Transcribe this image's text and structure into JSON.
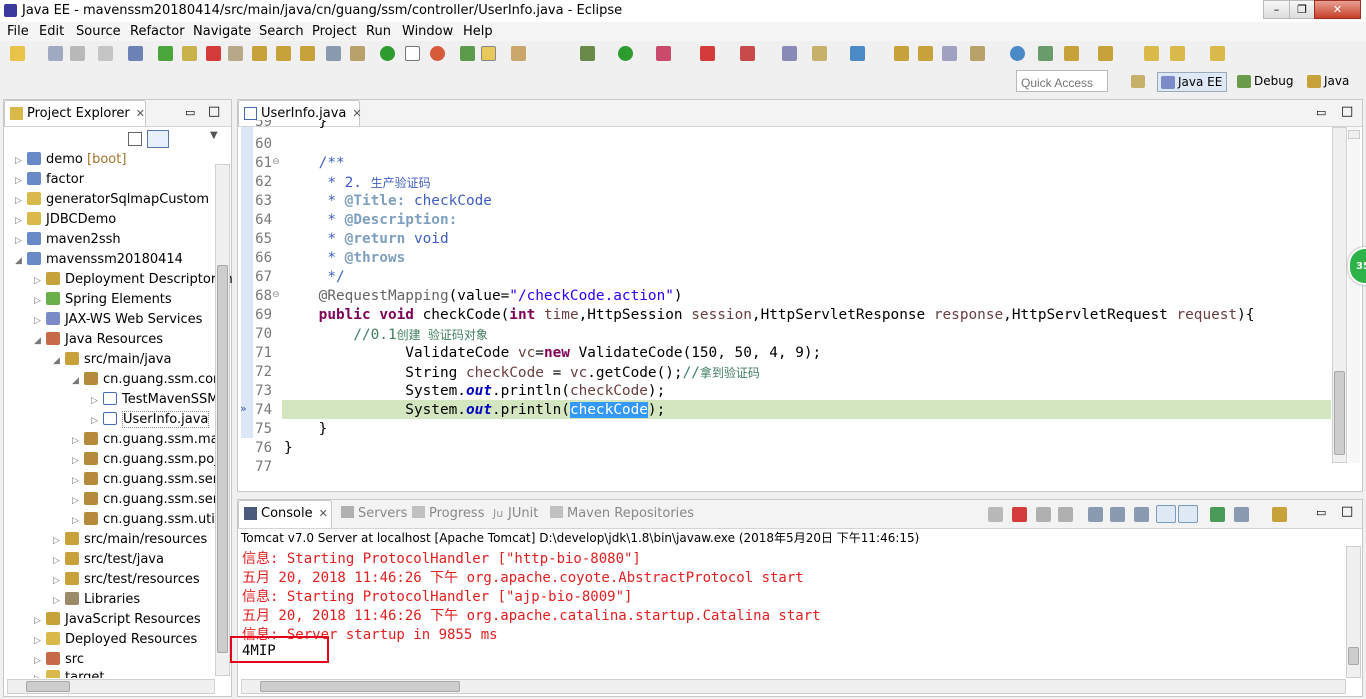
{
  "window": {
    "title": "Java EE - mavenssm20180414/src/main/java/cn/guang/ssm/controller/UserInfo.java - Eclipse",
    "minimize": "–",
    "restore": "❐",
    "close": "✕"
  },
  "menu": [
    "File",
    "Edit",
    "Source",
    "Refactor",
    "Navigate",
    "Search",
    "Project",
    "Run",
    "Window",
    "Help"
  ],
  "quick_access": {
    "placeholder": "Quick Access"
  },
  "perspectives": [
    "Java EE",
    "Debug",
    "Java"
  ],
  "project_explorer": {
    "title": "Project Explorer",
    "items": [
      {
        "label": "demo",
        "decor": "[boot]"
      },
      {
        "label": "factor"
      },
      {
        "label": "generatorSqlmapCustom"
      },
      {
        "label": "JDBCDemo"
      },
      {
        "label": "maven2ssh"
      },
      {
        "label": "mavenssm20180414"
      },
      {
        "label": "Deployment Descriptor: n"
      },
      {
        "label": "Spring Elements"
      },
      {
        "label": "JAX-WS Web Services"
      },
      {
        "label": "Java Resources"
      },
      {
        "label": "src/main/java"
      },
      {
        "label": "cn.guang.ssm.cont"
      },
      {
        "label": "TestMavenSSM"
      },
      {
        "label": "UserInfo.java"
      },
      {
        "label": "cn.guang.ssm.map"
      },
      {
        "label": "cn.guang.ssm.pojc"
      },
      {
        "label": "cn.guang.ssm.serv"
      },
      {
        "label": "cn.guang.ssm.serv"
      },
      {
        "label": "cn.guang.ssm.utils"
      },
      {
        "label": "src/main/resources"
      },
      {
        "label": "src/test/java"
      },
      {
        "label": "src/test/resources"
      },
      {
        "label": "Libraries"
      },
      {
        "label": "JavaScript Resources"
      },
      {
        "label": "Deployed Resources"
      },
      {
        "label": "src"
      },
      {
        "label": "target"
      }
    ]
  },
  "editor": {
    "tab": "UserInfo.java",
    "line_numbers": [
      "59",
      "60",
      "61",
      "62",
      "63",
      "64",
      "65",
      "66",
      "67",
      "68",
      "69",
      "70",
      "71",
      "72",
      "73",
      "74",
      "75",
      "76",
      "77"
    ],
    "code": {
      "l59": "    }",
      "l61": "    /**",
      "l62a": "     * 2. ",
      "l62b": "生产验证码",
      "l63a": "     * ",
      "l63b": "@Title:",
      "l63c": " checkCode",
      "l64a": "     * ",
      "l64b": "@Description:",
      "l65a": "     * ",
      "l65b": "@return",
      "l65c": " void",
      "l66a": "     * ",
      "l66b": "@throws",
      "l67": "     */",
      "l68a": "    @RequestMapping",
      "l68b": "(value=",
      "l68c": "\"/checkCode.action\"",
      "l68d": ")",
      "l69kw1": "public",
      "l69kw2": "void",
      "l69a": " checkCode(",
      "l69kw3": "int",
      "l69b": "time",
      "l69c": ",HttpSession ",
      "l69d": "session",
      "l69e": ",HttpServletResponse ",
      "l69f": "response",
      "l69g": ",HttpServletRequest ",
      "l69h": "request",
      "l69i": "){",
      "l70a": "//0.1",
      "l70b": "创建 验证码对象",
      "l71a": "ValidateCode ",
      "l71b": "vc",
      "l71c": "=",
      "l71kw": "new",
      "l71d": " ValidateCode(150, 50, 4, 9);",
      "l72a": "String ",
      "l72b": "checkCode",
      "l72c": " = ",
      "l72d": "vc",
      "l72e": ".getCode();",
      "l72f": "//",
      "l72g": "拿到验证码",
      "l73a": "System.",
      "l73b": "out",
      "l73c": ".println(",
      "l73d": "checkCode",
      "l73e": ");",
      "l74a": "System.",
      "l74b": "out",
      "l74c": ".println(",
      "l74d": "checkCode",
      "l74e": ");",
      "l75": "    }",
      "l76": "}"
    }
  },
  "bottom_tabs": [
    "Console",
    "Servers",
    "Progress",
    "JUnit",
    "Maven Repositories"
  ],
  "console": {
    "header": "Tomcat v7.0 Server at localhost [Apache Tomcat] D:\\develop\\jdk\\1.8\\bin\\javaw.exe (2018年5月20日 下午11:46:15)",
    "lines": [
      "信息: Starting ProtocolHandler [\"http-bio-8080\"]",
      "五月 20, 2018 11:46:26 下午 org.apache.coyote.AbstractProtocol start",
      "信息: Starting ProtocolHandler [\"ajp-bio-8009\"]",
      "五月 20, 2018 11:46:26 下午 org.apache.catalina.startup.Catalina start",
      "信息: Server startup in 9855 ms",
      "4MIP"
    ]
  },
  "badge": "35",
  "colors": {
    "highlight_line": "#d4e6c0",
    "selection": "#3399ff",
    "console_error": "#e21e1e",
    "annotation_box": "#e5001b"
  }
}
